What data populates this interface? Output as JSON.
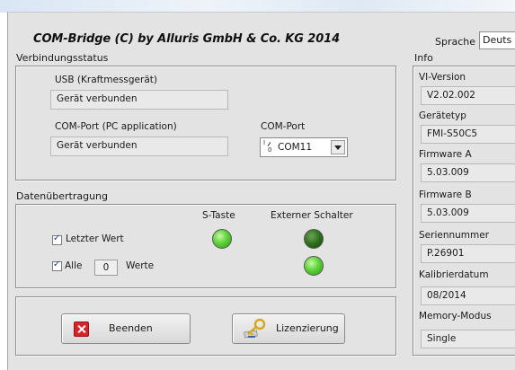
{
  "app": {
    "title": "COM-Bridge (C) by Alluris GmbH & Co. KG 2014",
    "language_label": "Sprache",
    "language_value": "Deuts"
  },
  "connection": {
    "section_label": "Verbindungsstatus",
    "usb_label": "USB (Kraftmessgerät)",
    "usb_status": "Gerät verbunden",
    "comport_app_label": "COM-Port (PC application)",
    "comport_app_status": "Gerät verbunden",
    "comport_label": "COM-Port",
    "comport_value": "COM11"
  },
  "transfer": {
    "section_label": "Datenübertragung",
    "col_s_taste": "S-Taste",
    "col_extern": "Externer Schalter",
    "last_value_label": "Letzter Wert",
    "last_value_checked": true,
    "all_label": "Alle",
    "all_checked": true,
    "all_count": "0",
    "values_label": "Werte",
    "led_s_taste_row1": "on",
    "led_extern_row1": "off",
    "led_extern_row2": "on"
  },
  "buttons": {
    "exit_label": "Beenden",
    "license_label": "Lizenzierung"
  },
  "info": {
    "section_label": "Info",
    "items": [
      {
        "label": "VI-Version",
        "value": "V2.02.002"
      },
      {
        "label": "Gerätetyp",
        "value": "FMI-S50C5"
      },
      {
        "label": "Firmware A",
        "value": "5.03.009"
      },
      {
        "label": "Firmware B",
        "value": "5.03.009"
      },
      {
        "label": "Seriennummer",
        "value": "P.26901"
      },
      {
        "label": "Kalibrierdatum",
        "value": "08/2014"
      },
      {
        "label": "Memory-Modus",
        "value": "Single"
      }
    ]
  },
  "icons": {
    "exit": "close-x-icon",
    "license": "key-icon",
    "comport": "io-port-icon",
    "dropdown": "chevron-down-icon"
  },
  "colors": {
    "led_on": "#5ed33a",
    "led_off": "#2d6f1d",
    "exit_icon": "#d8232a"
  }
}
